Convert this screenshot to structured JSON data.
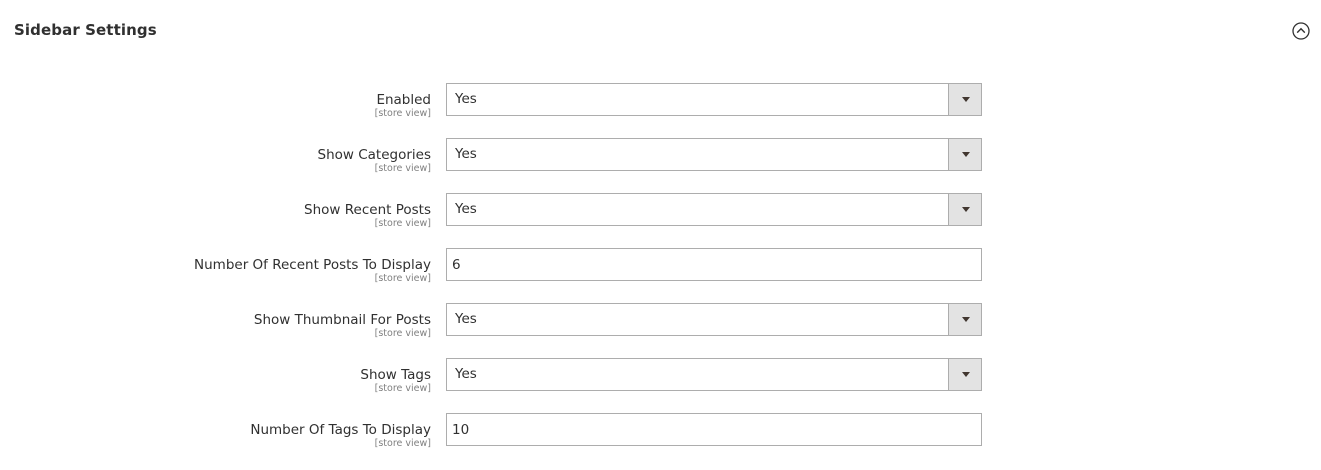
{
  "section": {
    "title": "Sidebar Settings",
    "collapse_icon": "chevron-up-circle-icon"
  },
  "fields": [
    {
      "label": "Enabled",
      "scope": "[store view]",
      "type": "select",
      "value": "Yes"
    },
    {
      "label": "Show Categories",
      "scope": "[store view]",
      "type": "select",
      "value": "Yes"
    },
    {
      "label": "Show Recent Posts",
      "scope": "[store view]",
      "type": "select",
      "value": "Yes"
    },
    {
      "label": "Number Of Recent Posts To Display",
      "scope": "[store view]",
      "type": "text",
      "value": "6"
    },
    {
      "label": "Show Thumbnail For Posts",
      "scope": "[store view]",
      "type": "select",
      "value": "Yes"
    },
    {
      "label": "Show Tags",
      "scope": "[store view]",
      "type": "select",
      "value": "Yes"
    },
    {
      "label": "Number Of Tags To Display",
      "scope": "[store view]",
      "type": "text",
      "value": "10"
    }
  ]
}
